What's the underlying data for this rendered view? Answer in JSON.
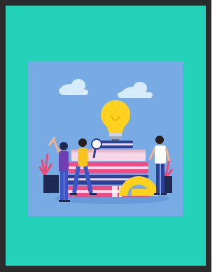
{
  "card": {
    "background_color": "#24d1b9",
    "frame_color": "#2b2b2b"
  },
  "illustration": {
    "subject": "team-with-books-and-lightbulb",
    "background_color": "#78abe4",
    "colors": {
      "bulb": "#ffd21f",
      "book_pink": "#ee4c86",
      "book_navy": "#2f3f96",
      "book_light": "#f7d7e6",
      "person_shirt_yellow": "#f6c21b",
      "person_pants_blue": "#3f55c4",
      "cloud": "#d6ebfb"
    }
  }
}
